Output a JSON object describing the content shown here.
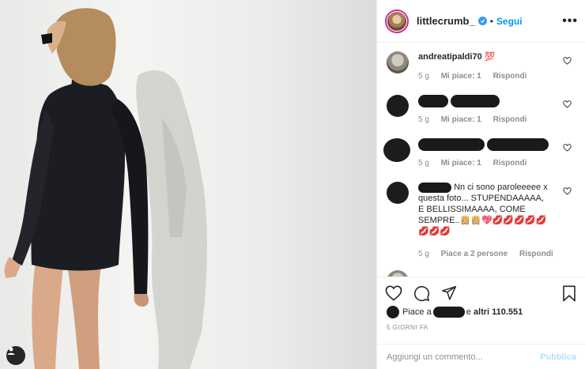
{
  "post": {
    "username": "littlecrumb_",
    "separator": "•",
    "follow_label": "Segui",
    "more_label": "•••"
  },
  "comments": [
    {
      "user": "andreatipaldi70",
      "text": "💯",
      "time": "5 g",
      "likes": "Mi piace: 1",
      "reply": "Rispondi"
    },
    {
      "user": "",
      "text": "",
      "time": "5 g",
      "likes": "Mi piace: 1",
      "reply": "Rispondi"
    },
    {
      "user": "",
      "text": "",
      "time": "5 g",
      "likes": "Mi piace: 1",
      "reply": "Rispondi"
    },
    {
      "user": "",
      "text": "Nn ci sono paroleeeee x questa foto... STUPENDAAAAA, E BELLISSIMAAAA, COME SEMPRE..👸🏼👸🏼💖💋💋💋💋💋💋💋💋",
      "time": "5 g",
      "likes": "Piace a 2 persone",
      "reply": "Rispondi"
    }
  ],
  "likes_bar": {
    "prefix": "Piace a",
    "connector": "e",
    "others": "altri 110.551"
  },
  "post_date": "5 GIORNI FA",
  "add_comment": {
    "placeholder": "Aggiungi un commento...",
    "publish_label": "Pubblica"
  },
  "icons": [
    "heart-icon",
    "comment-icon",
    "share-icon",
    "bookmark-icon",
    "verified-icon",
    "user-tag-icon"
  ],
  "colors": {
    "accent": "#0095f6",
    "publish_disabled": "#b2dffc",
    "text": "#262626",
    "muted": "#8e8e8e",
    "border": "#efefef"
  }
}
